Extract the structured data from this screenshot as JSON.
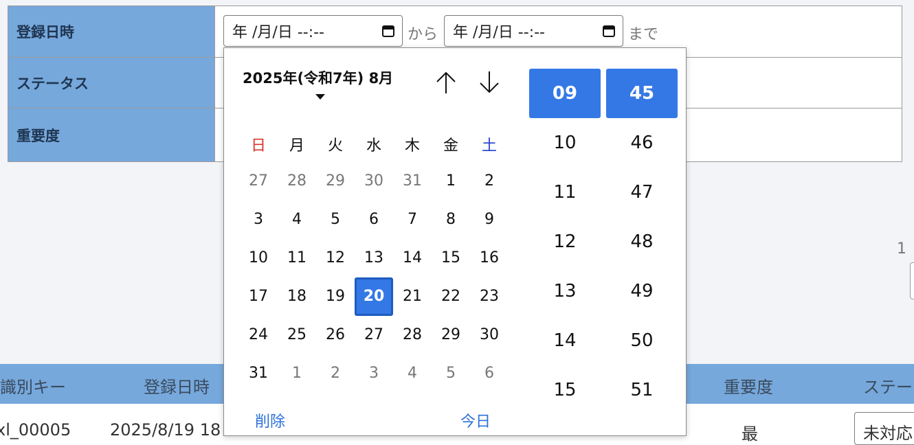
{
  "filter": {
    "rows": [
      {
        "label": "登録日時"
      },
      {
        "label": "ステータス"
      },
      {
        "label": "重要度"
      }
    ],
    "date_from": {
      "value": "年 /月/日  --:--"
    },
    "date_to": {
      "value": "年 /月/日  --:--"
    },
    "from_text": "から",
    "to_text": "まで"
  },
  "pager": {
    "text": "1"
  },
  "results": {
    "headers": [
      "識別キー",
      "登録日時",
      "重要度",
      "ステー"
    ],
    "row": {
      "key": "xl_00005",
      "date": "2025/8/19 18",
      "importance": "最",
      "status": "未対応"
    }
  },
  "calendar": {
    "month_label": "2025年(令和7年) 8月",
    "weekdays": [
      "日",
      "月",
      "火",
      "水",
      "木",
      "金",
      "土"
    ],
    "weekday_colors": {
      "sunday": "#d9342b",
      "saturday": "#1f3fd0",
      "default": "#111111"
    },
    "weeks": [
      [
        {
          "d": "27",
          "o": true
        },
        {
          "d": "28",
          "o": true
        },
        {
          "d": "29",
          "o": true
        },
        {
          "d": "30",
          "o": true
        },
        {
          "d": "31",
          "o": true
        },
        {
          "d": "1"
        },
        {
          "d": "2"
        }
      ],
      [
        {
          "d": "3"
        },
        {
          "d": "4"
        },
        {
          "d": "5"
        },
        {
          "d": "6"
        },
        {
          "d": "7"
        },
        {
          "d": "8"
        },
        {
          "d": "9"
        }
      ],
      [
        {
          "d": "10"
        },
        {
          "d": "11"
        },
        {
          "d": "12"
        },
        {
          "d": "13"
        },
        {
          "d": "14"
        },
        {
          "d": "15"
        },
        {
          "d": "16"
        }
      ],
      [
        {
          "d": "17"
        },
        {
          "d": "18"
        },
        {
          "d": "19"
        },
        {
          "d": "20",
          "sel": true
        },
        {
          "d": "21"
        },
        {
          "d": "22"
        },
        {
          "d": "23"
        }
      ],
      [
        {
          "d": "24"
        },
        {
          "d": "25"
        },
        {
          "d": "26"
        },
        {
          "d": "27"
        },
        {
          "d": "28"
        },
        {
          "d": "29"
        },
        {
          "d": "30"
        }
      ],
      [
        {
          "d": "31"
        },
        {
          "d": "1",
          "o": true
        },
        {
          "d": "2",
          "o": true
        },
        {
          "d": "3",
          "o": true
        },
        {
          "d": "4",
          "o": true
        },
        {
          "d": "5",
          "o": true
        },
        {
          "d": "6",
          "o": true
        }
      ]
    ],
    "clear_label": "削除",
    "today_label": "今日",
    "hours": [
      "09",
      "10",
      "11",
      "12",
      "13",
      "14",
      "15"
    ],
    "minutes": [
      "45",
      "46",
      "47",
      "48",
      "49",
      "50",
      "51"
    ],
    "selected_hour": "09",
    "selected_minute": "45",
    "accent_color": "#3478e6",
    "icons": {
      "up": "arrow-up-icon",
      "down": "arrow-down-icon"
    }
  }
}
